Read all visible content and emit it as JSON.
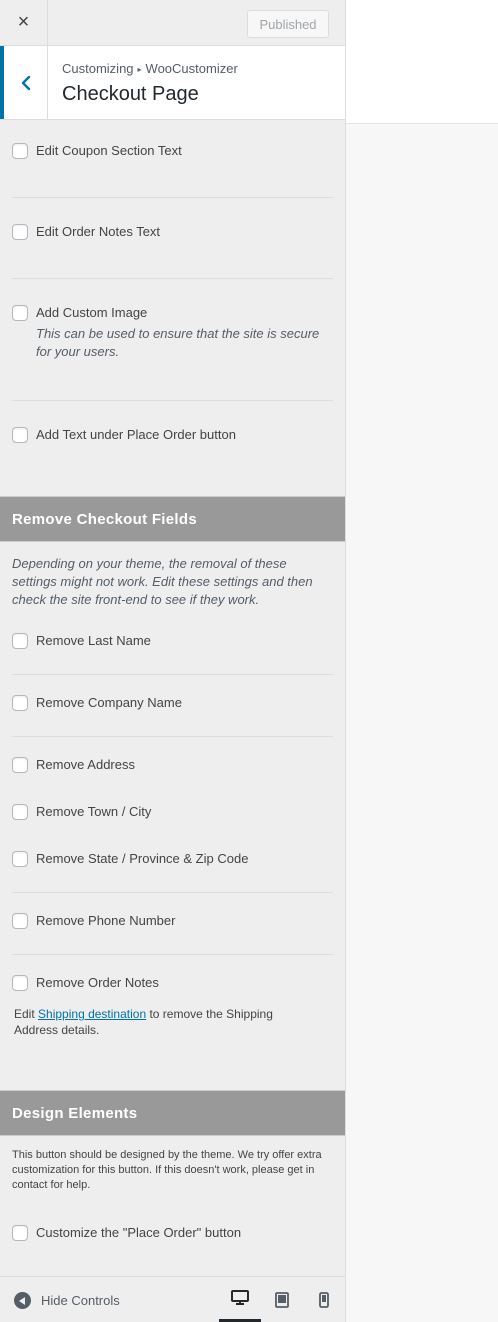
{
  "header": {
    "close_label": "×",
    "publish_label": "Published"
  },
  "section": {
    "breadcrumb_root": "Customizing",
    "breadcrumb_sep": "▸",
    "breadcrumb_leaf": "WooCustomizer",
    "title": "Checkout Page"
  },
  "controls": {
    "coupon_text": "Edit Coupon Section Text",
    "order_notes_text": "Edit Order Notes Text",
    "custom_image": "Add Custom Image",
    "custom_image_desc": "This can be used to ensure that the site is secure for your users.",
    "place_order_text": "Add Text under Place Order button"
  },
  "remove_fields": {
    "heading": "Remove Checkout Fields",
    "note": "Depending on your theme, the removal of these settings might not work. Edit these settings and then check the site front-end to see if they work.",
    "last_name": "Remove Last Name",
    "company": "Remove Company Name",
    "address": "Remove Address",
    "town": "Remove Town / City",
    "state_zip": "Remove State / Province & Zip Code",
    "phone": "Remove Phone Number",
    "order_notes": "Remove Order Notes",
    "ship_prefix": "Edit",
    "ship_link": "Shipping destination",
    "ship_suffix": "to remove the Shipping Address details."
  },
  "design": {
    "heading": "Design Elements",
    "note": "This button should be designed by the theme. We try offer extra customization for this button. If this doesn't work, please get in contact for help.",
    "place_order_button": "Customize the \"Place Order\" button"
  },
  "footer": {
    "hide_label": "Hide Controls",
    "active_device": "desktop"
  },
  "colors": {
    "accent": "#0073aa",
    "group_header": "#999999",
    "panel_bg": "#eeeeee"
  }
}
